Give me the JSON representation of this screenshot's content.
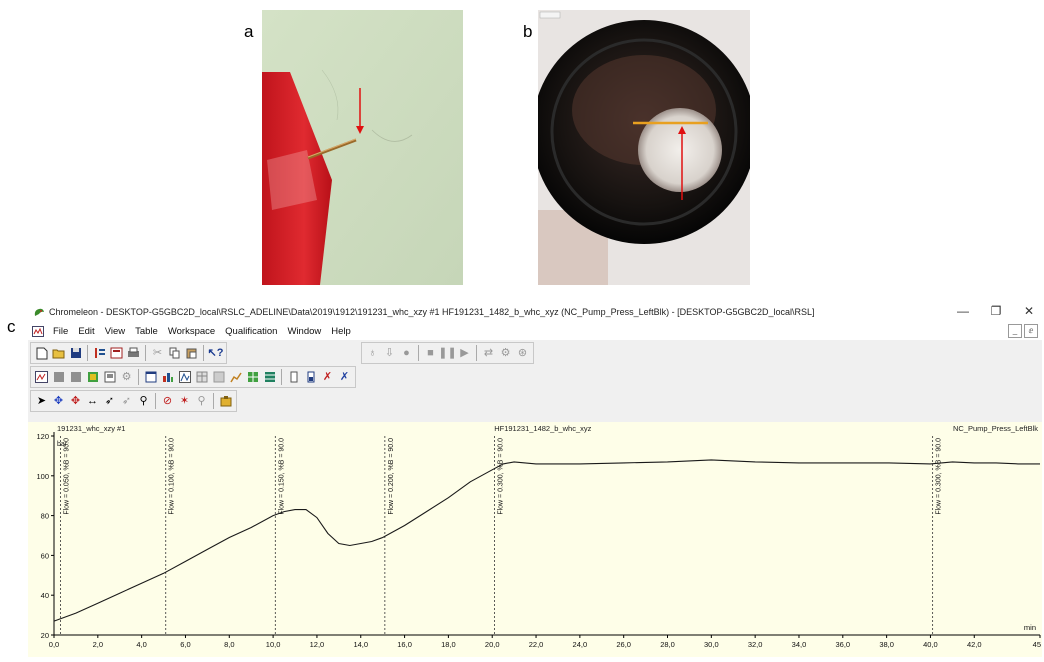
{
  "panels": {
    "a": "a",
    "b": "b",
    "c": "c"
  },
  "window": {
    "title": "Chromeleon - DESKTOP-G5GBC2D_local\\RSLC_ADELINE\\Data\\2019\\1912\\191231_whc_xzy #1 HF191231_1482_b_whc_xyz (NC_Pump_Press_LeftBlk) - [DESKTOP-G5GBC2D_local\\RSL]",
    "minimize": "—",
    "restore": "❐",
    "close": "✕"
  },
  "menu": [
    "File",
    "Edit",
    "View",
    "Table",
    "Workspace",
    "Qualification",
    "Window",
    "Help"
  ],
  "mdi": [
    "_",
    "ⅇ"
  ],
  "chart": {
    "header_left": "191231_whc_xzy #1",
    "header_center": "HF191231_1482_b_whc_xyz",
    "header_right": "NC_Pump_Press_LeftBlk",
    "x_unit": "min",
    "y_corner_label": "bar",
    "colors": {
      "background": "#fefee8",
      "trace": "#1a1a1a",
      "marker": "#333333"
    }
  },
  "chart_data": {
    "type": "line",
    "xlim": [
      0,
      45
    ],
    "ylim": [
      20,
      120
    ],
    "x_ticks": [
      "0,0",
      "2,0",
      "4,0",
      "6,0",
      "8,0",
      "10,0",
      "12,0",
      "14,0",
      "16,0",
      "18,0",
      "20,0",
      "22,0",
      "24,0",
      "26,0",
      "28,0",
      "30,0",
      "32,0",
      "34,0",
      "36,0",
      "38,0",
      "40,0",
      "42,0",
      "45"
    ],
    "x_tick_values": [
      0,
      2,
      4,
      6,
      8,
      10,
      12,
      14,
      16,
      18,
      20,
      22,
      24,
      26,
      28,
      30,
      32,
      34,
      36,
      38,
      40,
      42,
      45
    ],
    "y_ticks": [
      "20",
      "40",
      "60",
      "80",
      "100",
      "120"
    ],
    "y_tick_values": [
      20,
      40,
      60,
      80,
      100,
      120
    ],
    "series": [
      {
        "x": [
          0,
          1,
          2,
          3,
          4,
          5,
          6,
          7,
          8,
          9,
          10,
          10.5,
          11,
          11.5,
          12,
          12.5,
          13,
          13.5,
          14,
          14.5,
          15,
          16,
          17,
          18,
          19,
          20,
          20.5,
          21,
          22,
          24,
          26,
          28,
          30,
          32,
          34,
          36,
          38,
          40,
          41,
          42,
          43,
          44,
          45
        ],
        "y": [
          27,
          31,
          36,
          41,
          46,
          51,
          57,
          63,
          69,
          74,
          80,
          82,
          83,
          83,
          79,
          71,
          66,
          65,
          66,
          67,
          69,
          75,
          82,
          89,
          97,
          103,
          106,
          107,
          106,
          106,
          106.5,
          107,
          108,
          107,
          106.5,
          106.5,
          106.5,
          106,
          107,
          106.5,
          106.5,
          106,
          106
        ]
      }
    ],
    "markers": [
      {
        "x": 0.3,
        "label": "Flow = 0.050, %B = 90.0"
      },
      {
        "x": 5.1,
        "label": "Flow = 0.100, %B = 90.0"
      },
      {
        "x": 10.1,
        "label": "Flow = 0.150, %B = 90.0"
      },
      {
        "x": 15.1,
        "label": "Flow = 0.200, %B = 90.0"
      },
      {
        "x": 20.1,
        "label": "Flow = 0.300, %B = 90.0"
      },
      {
        "x": 40.1,
        "label": "Flow = 0.300, %B = 90.0"
      }
    ]
  }
}
